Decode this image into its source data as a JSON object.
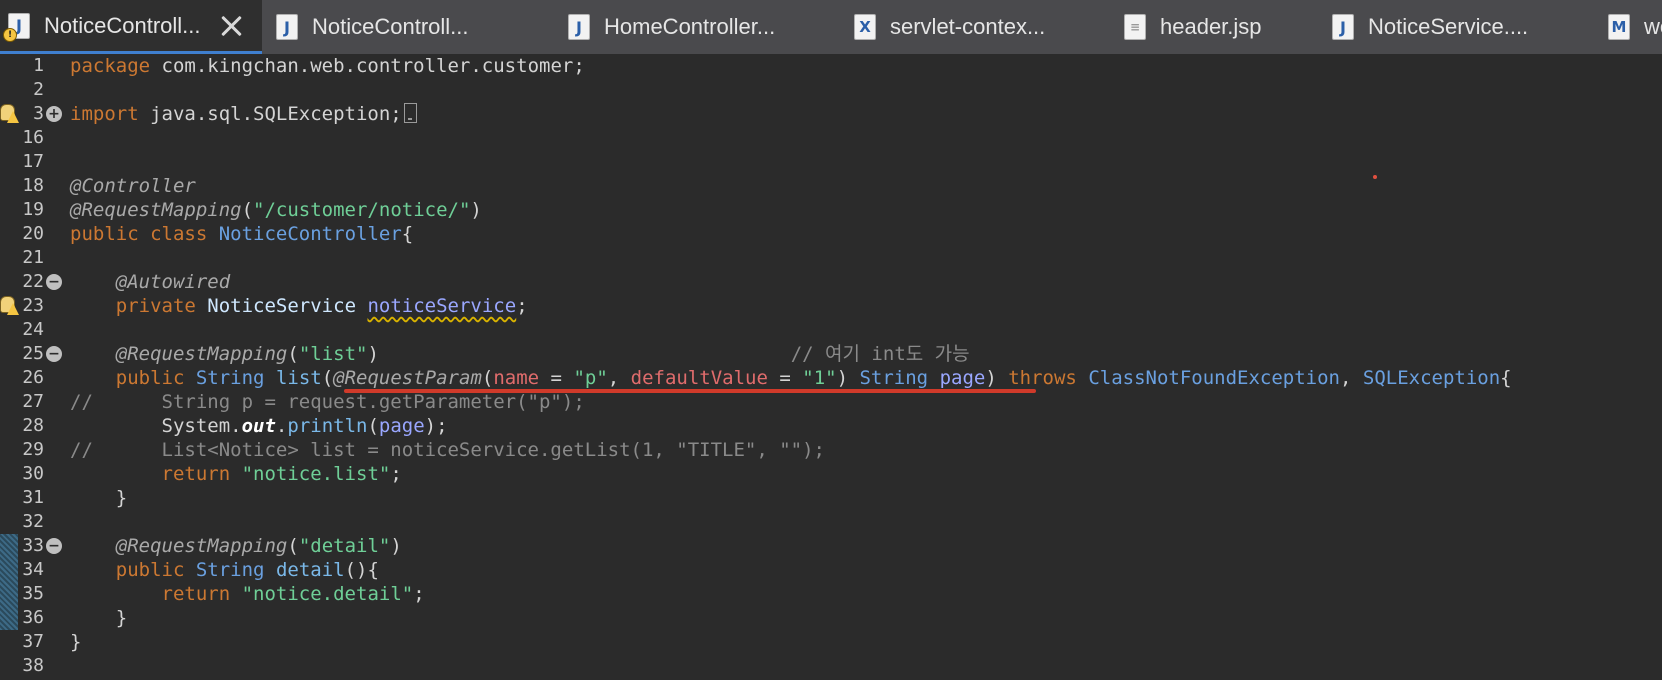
{
  "tabs": [
    {
      "label": "NoticeControll...",
      "icon": "java-file-icon",
      "active": true,
      "warning": true
    },
    {
      "label": "NoticeControll...",
      "icon": "java-file-icon"
    },
    {
      "label": "HomeController...",
      "icon": "java-file-icon"
    },
    {
      "label": "servlet-contex...",
      "icon": "xml-file-icon"
    },
    {
      "label": "header.jsp",
      "icon": "jsp-file-icon"
    },
    {
      "label": "NoticeService....",
      "icon": "java-file-icon"
    },
    {
      "label": "we",
      "icon": "xml-file-icon"
    }
  ],
  "code": {
    "l1": {
      "num": "1",
      "t": [
        "package",
        " com.kingchan.web.controller.customer;"
      ]
    },
    "l2": {
      "num": "2"
    },
    "l3": {
      "num": "3",
      "t": [
        "import",
        " java.sql.SQLException;"
      ]
    },
    "l16": {
      "num": "16"
    },
    "l17": {
      "num": "17"
    },
    "l18": {
      "num": "18",
      "t": [
        "@Controller"
      ]
    },
    "l19": {
      "num": "19",
      "t": [
        "@RequestMapping",
        "(",
        "\"/customer/notice/\"",
        ")"
      ]
    },
    "l20": {
      "num": "20",
      "t": [
        "public class",
        " ",
        "NoticeController",
        "{"
      ]
    },
    "l21": {
      "num": "21"
    },
    "l22": {
      "num": "22",
      "t": [
        "    ",
        "@Autowired"
      ]
    },
    "l23": {
      "num": "23",
      "t": [
        "    ",
        "private",
        " ",
        "NoticeService",
        " ",
        "noticeService",
        ";"
      ]
    },
    "l24": {
      "num": "24"
    },
    "l25": {
      "num": "25",
      "t": [
        "    ",
        "@RequestMapping",
        "(",
        "\"list\"",
        ")",
        "                                    ",
        "// 여기 int도 가능"
      ]
    },
    "l26": {
      "num": "26",
      "t": [
        "    ",
        "public",
        " ",
        "String",
        " ",
        "list",
        "(",
        "@RequestParam",
        "(",
        "name",
        " = ",
        "\"p\"",
        ", ",
        "defaultValue",
        " = ",
        "\"1\"",
        ") ",
        "String",
        " ",
        "page",
        ") ",
        "throws",
        " ",
        "ClassNotFoundException",
        ", ",
        "SQLException",
        "{"
      ]
    },
    "l27": {
      "num": "27",
      "t": [
        "//      String p = request.getParameter(\"p\");"
      ]
    },
    "l28": {
      "num": "28",
      "t": [
        "        ",
        "System.",
        "out",
        ".",
        "println",
        "(",
        "page",
        ");"
      ]
    },
    "l29": {
      "num": "29",
      "t": [
        "//      List<Notice> list = noticeService.getList(1, \"TITLE\", \"\");"
      ]
    },
    "l30": {
      "num": "30",
      "t": [
        "        ",
        "return",
        " ",
        "\"notice.list\"",
        ";"
      ]
    },
    "l31": {
      "num": "31",
      "t": [
        "    }"
      ]
    },
    "l32": {
      "num": "32"
    },
    "l33": {
      "num": "33",
      "t": [
        "    ",
        "@RequestMapping",
        "(",
        "\"detail\"",
        ")"
      ]
    },
    "l34": {
      "num": "34",
      "t": [
        "    ",
        "public",
        " ",
        "String",
        " ",
        "detail",
        "(){"
      ]
    },
    "l35": {
      "num": "35",
      "t": [
        "        ",
        "return",
        " ",
        "\"notice.detail\"",
        ";"
      ]
    },
    "l36": {
      "num": "36",
      "t": [
        "    }"
      ]
    },
    "l37": {
      "num": "37",
      "t": [
        "}"
      ]
    },
    "l38": {
      "num": "38"
    }
  },
  "fold_icons": {
    "collapsed": "+",
    "expanded": "−"
  },
  "colors": {
    "background": "#2b2b2b",
    "keyword": "#cc7832",
    "string": "#6fcf97",
    "type": "#6aa0e0",
    "highlight_underline": "#d03a2a"
  }
}
